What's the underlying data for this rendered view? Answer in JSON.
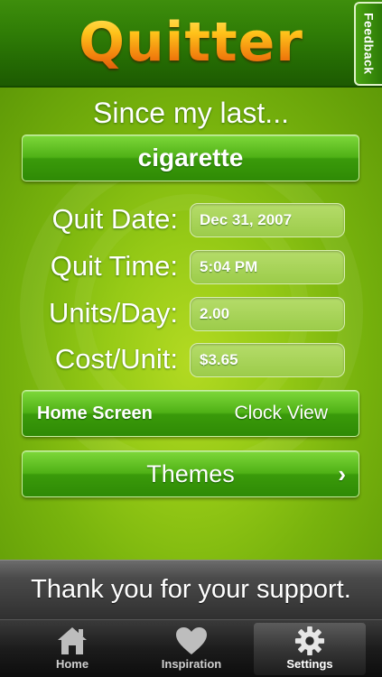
{
  "app": {
    "logo_text": "Quitter",
    "feedback_label": "Feedback"
  },
  "main": {
    "heading": "Since my last...",
    "item_label": "cigarette",
    "fields": [
      {
        "label": "Quit Date:",
        "value": "Dec 31, 2007"
      },
      {
        "label": "Quit Time:",
        "value": "5:04 PM"
      },
      {
        "label": "Units/Day:",
        "value": "2.00"
      },
      {
        "label": "Cost/Unit:",
        "value": "$3.65"
      }
    ],
    "home_screen": {
      "label": "Home Screen",
      "value": "Clock View"
    },
    "themes": {
      "label": "Themes",
      "chevron": "›"
    }
  },
  "footer": {
    "support_text": "Thank you for your support."
  },
  "tabs": [
    {
      "label": "Home",
      "icon": "home-icon",
      "active": false
    },
    {
      "label": "Inspiration",
      "icon": "heart-icon",
      "active": false
    },
    {
      "label": "Settings",
      "icon": "gear-icon",
      "active": true
    }
  ],
  "colors": {
    "header_green": "#2f7c06",
    "button_green": "#4fb116",
    "background_lime": "#96ca16",
    "logo_orange": "#f07a0c",
    "support_bar": "#4a4a4a",
    "tabbar": "#1c1c1c"
  }
}
